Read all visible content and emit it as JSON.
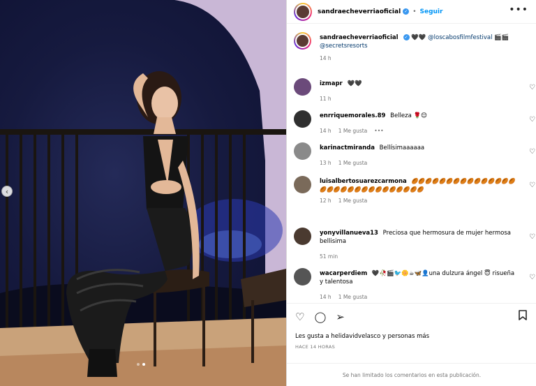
{
  "post": {
    "username": "sandraecheverriaoficial",
    "follow_label": "Seguir",
    "separator": "•",
    "more_label": "•••",
    "caption_emoji": "🖤🖤",
    "caption_mention_1": "@loscabosfilmfestival",
    "caption_emoji_2": "🎬🎬",
    "caption_mention_2": "@secretsresorts",
    "caption_time": "14 h",
    "likes_text": "Les gusta a helidavidvelasco y personas más",
    "date_text": "HACE 14 HORAS",
    "comments_limited_text": "Se han limitado los comentarios en esta publicación."
  },
  "comments": [
    {
      "user": "izmapr",
      "text": "🖤🖤",
      "time": "11 h",
      "likes": ""
    },
    {
      "user": "enrriquemorales.89",
      "text": "Belleza 🌹😊",
      "time": "14 h",
      "likes": "1 Me gusta",
      "more": "•••"
    },
    {
      "user": "karinactmiranda",
      "text": "Bellísimaaaaaa",
      "time": "13 h",
      "likes": "1 Me gusta"
    },
    {
      "user": "luisalbertosuarezcarmona",
      "text": "🏉🏉🏉🏉🏉🏉🏉🏉🏉🏉🏉🏉🏉🏉🏉🏉🏉🏉🏉🏉🏉🏉🏉🏉🏉🏉🏉🏉🏉🏉",
      "time": "12 h",
      "likes": "1 Me gusta"
    },
    {
      "user": "yonyvillanueva13",
      "text": "Preciosa que hermosura de mujer hermosa bellisima",
      "time": "51 min",
      "likes": ""
    },
    {
      "user": "wacarperdiem",
      "text": "🖤🥀🎬🐦🌼☕🦋👤una dulzura ángel 😇 risueña y talentosa",
      "time": "14 h",
      "likes": "1 Me gusta"
    }
  ],
  "icons": {
    "verified": "verified-badge-icon",
    "heart": "♡",
    "like": "♡",
    "comment": "◯",
    "share": "➢",
    "bookmark": "🔖",
    "prev": "‹"
  },
  "colors": {
    "link": "#0095f6",
    "mention": "#00376b",
    "muted": "#737373"
  }
}
